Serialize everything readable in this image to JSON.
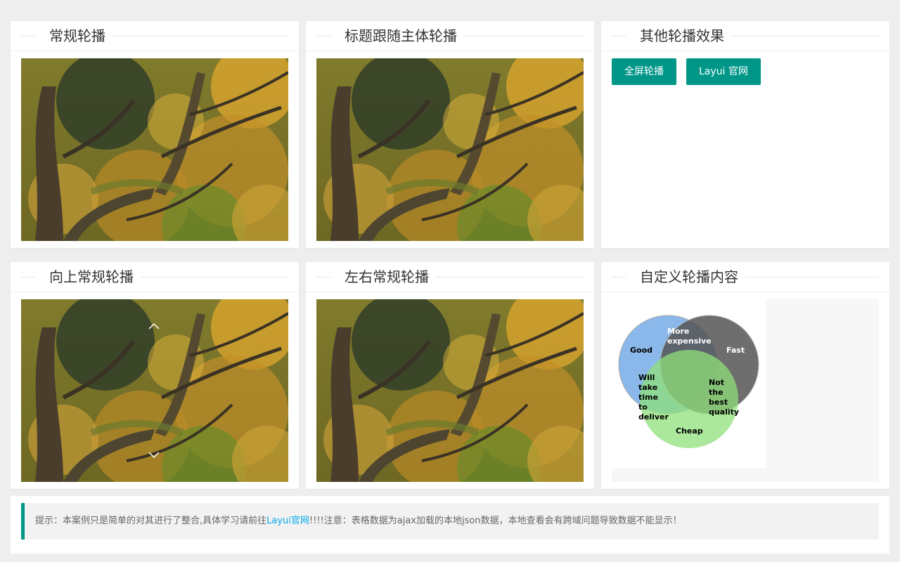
{
  "panels": {
    "normal": {
      "title": "常规轮播"
    },
    "title_follow": {
      "title": "标题跟随主体轮播"
    },
    "other": {
      "title": "其他轮播效果"
    },
    "up": {
      "title": "向上常规轮播"
    },
    "left_right": {
      "title": "左右常规轮播"
    },
    "custom": {
      "title": "自定义轮播内容"
    }
  },
  "buttons": {
    "fullscreen": "全屏轮播",
    "official": "Layui 官网"
  },
  "venn": {
    "good": "Good",
    "more_expensive_1": "More",
    "more_expensive_2": "expensive",
    "fast": "Fast",
    "will_1": "Will",
    "will_2": "take",
    "will_3": "time",
    "will_4": "to",
    "will_5": "deliver",
    "not_1": "Not",
    "not_2": "the",
    "not_3": "best",
    "not_4": "quality",
    "cheap": "Cheap",
    "colors": {
      "blue": "#8ab8ea",
      "dark": "#555555",
      "green": "#8fe07a"
    }
  },
  "tip": {
    "prefix": "提示：本案例只是简单的对其进行了整合,具体学习请前往",
    "link": "Layui官网",
    "suffix": "!!!!注意：表格数据为ajax加载的本地json数据，本地查看会有跨域问题导致数据不能显示！"
  },
  "colors": {
    "accent": "#009688",
    "link": "#01AAED"
  },
  "icons": {
    "up": "chevron-up-icon",
    "down": "chevron-down-icon"
  }
}
